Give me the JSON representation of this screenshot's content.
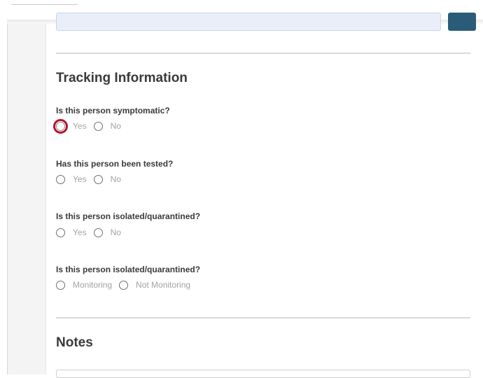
{
  "tracking": {
    "title": "Tracking Information",
    "questions": [
      {
        "label": "Is this person symptomatic?",
        "options": [
          "Yes",
          "No"
        ]
      },
      {
        "label": "Has this person been tested?",
        "options": [
          "Yes",
          "No"
        ]
      },
      {
        "label": "Is this person isolated/quarantined?",
        "options": [
          "Yes",
          "No"
        ]
      },
      {
        "label": "Is this person isolated/quarantined?",
        "options": [
          "Monitoring",
          "Not Monitoring"
        ]
      }
    ]
  },
  "notes": {
    "title": "Notes"
  },
  "colors": {
    "focus_outline": "#b5122f",
    "heading_text": "#3a3a3a",
    "option_text": "#a3a3a3",
    "prev_button": "#2a5c7a",
    "prev_field": "#e9eef8"
  }
}
